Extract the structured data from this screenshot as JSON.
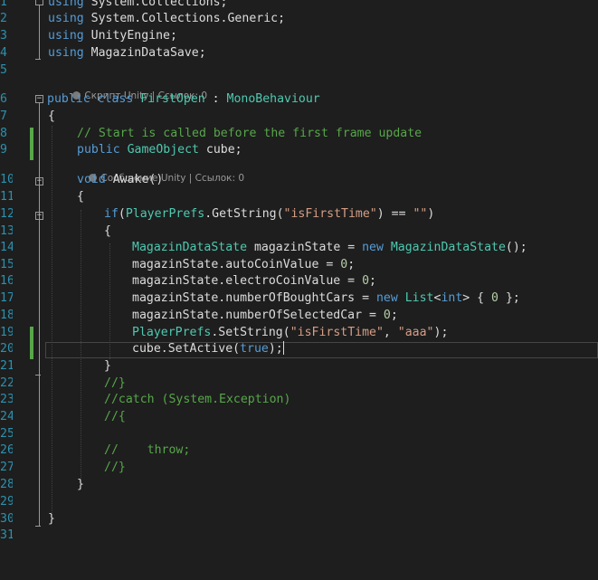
{
  "editor": {
    "line_numbers": [
      "1",
      "2",
      "3",
      "4",
      "5",
      "6",
      "7",
      "8",
      "9",
      "10",
      "11",
      "12",
      "13",
      "14",
      "15",
      "16",
      "17",
      "18",
      "19",
      "20",
      "21",
      "22",
      "23",
      "24",
      "25",
      "26",
      "27",
      "28",
      "29",
      "30",
      "31"
    ],
    "lens": {
      "class_lens": "Скрипт Unity | Ссылок: 0",
      "method_lens": "Сообщение Unity | Ссылок: 0"
    },
    "lines": {
      "l1": {
        "kw": "using",
        "rest": " System.Collections;"
      },
      "l2": {
        "kw": "using",
        "rest": " System.Collections.Generic;"
      },
      "l3": {
        "kw": "using",
        "rest": " UnityEngine;"
      },
      "l4": {
        "kw": "using",
        "rest": " MagazinDataSave;"
      },
      "l6": {
        "kw1": "public",
        "kw2": " class ",
        "name": "FirstOpen",
        "sep": " : ",
        "base": "MonoBehaviour"
      },
      "l7": {
        "text": "{"
      },
      "l8": {
        "comment": "// Start is called before the first frame update"
      },
      "l9": {
        "kw": "public",
        "type": " GameObject",
        "rest": " cube;"
      },
      "l10": {
        "kw": "void",
        "rest": " Awake()"
      },
      "l11": {
        "text": "{"
      },
      "l12": {
        "kw": "if",
        "open": "(",
        "type": "PlayerPrefs",
        "call": ".GetString(",
        "str1": "\"isFirstTime\"",
        "op": ") == ",
        "str2": "\"\"",
        "close": ")"
      },
      "l13": {
        "text": "{"
      },
      "l14": {
        "type": "MagazinDataState",
        "mid": " magazinState = ",
        "kw": "new",
        "type2": " MagazinDataState",
        "end": "();"
      },
      "l15": {
        "pre": "magazinState.autoCoinValue = ",
        "num": "0",
        "end": ";"
      },
      "l16": {
        "pre": "magazinState.electroCoinValue = ",
        "num": "0",
        "end": ";"
      },
      "l17": {
        "pre": "magazinState.numberOfBoughtCars = ",
        "kw": "new",
        "type": " List",
        "lt": "<",
        "kw2": "int",
        "gt": ">",
        "mid": " { ",
        "num": "0",
        "end": " };"
      },
      "l18": {
        "pre": "magazinState.numberOfSelectedCar = ",
        "num": "0",
        "end": ";"
      },
      "l19": {
        "type": "PlayerPrefs",
        "call": ".SetString(",
        "str1": "\"isFirstTime\"",
        "sep": ", ",
        "str2": "\"aaa\"",
        "end": ");"
      },
      "l20": {
        "pre": "cube.SetActive(",
        "kw": "true",
        "end": ");"
      },
      "l21": {
        "text": "}"
      },
      "l22": {
        "comment": "//}"
      },
      "l23": {
        "comment": "//catch (System.Exception)"
      },
      "l24": {
        "comment": "//{"
      },
      "l26": {
        "comment": "//    throw;"
      },
      "l27": {
        "comment": "//}"
      },
      "l28": {
        "text": "}"
      },
      "l30": {
        "text": "}"
      }
    },
    "colors": {
      "background": "#1e1e1e",
      "keyword": "#569cd6",
      "type": "#4ec9b0",
      "string": "#d69d85",
      "comment": "#57a64a",
      "number": "#b5cea8",
      "line_number": "#2b91af"
    },
    "icons": [
      "unity-script-icon",
      "unity-message-icon",
      "collapse-icon"
    ]
  }
}
